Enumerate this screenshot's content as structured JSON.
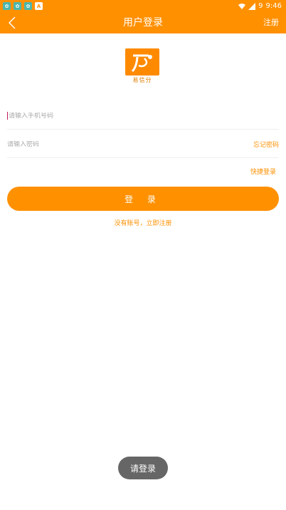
{
  "status_bar": {
    "time": "9:46",
    "notif_letter": "A",
    "battery_label": "9"
  },
  "app_bar": {
    "title": "用户登录",
    "register": "注册"
  },
  "logo": {
    "caption": "易信分"
  },
  "form": {
    "phone_placeholder": "请输入手机号码",
    "password_placeholder": "请输入密码",
    "forgot_password": "忘记密码",
    "quick_login": "快捷登录",
    "login_button": "登 录",
    "no_account": "没有账号，立即注册"
  },
  "toast": {
    "text": "请登录"
  },
  "colors": {
    "brand": "#ff9000",
    "toast_bg": "#666666"
  }
}
